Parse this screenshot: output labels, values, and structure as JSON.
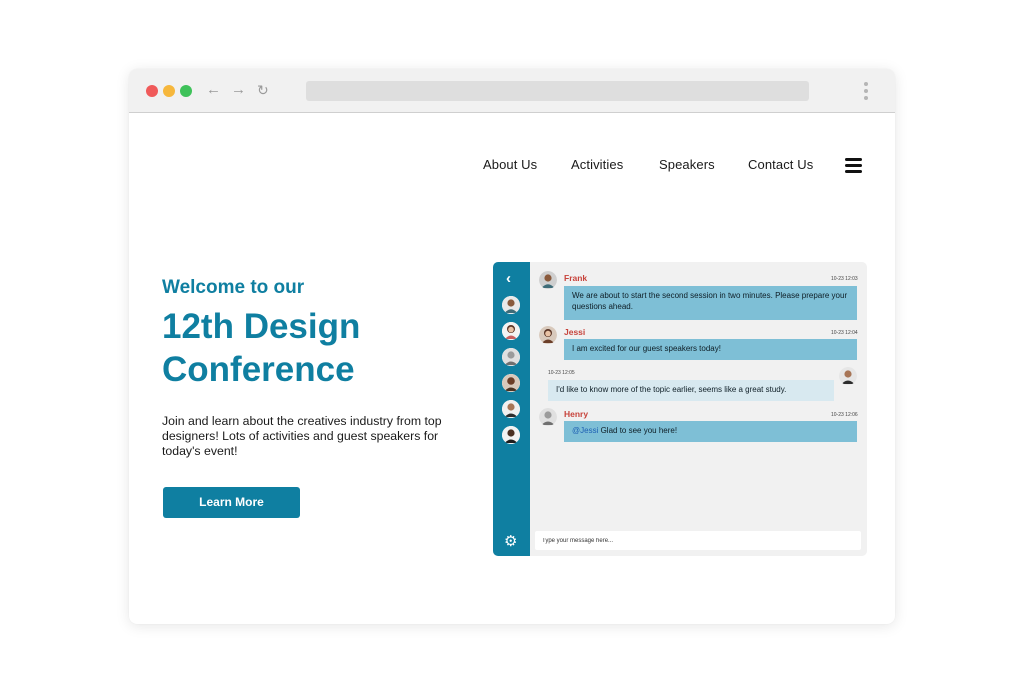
{
  "browser": {
    "back_icon": "←",
    "forward_icon": "→",
    "reload_icon": "↻"
  },
  "nav": {
    "about": "About Us",
    "activities": "Activities",
    "speakers": "Speakers",
    "contact": "Contact Us"
  },
  "hero": {
    "welcome": "Welcome to our",
    "title": "12th Design Conference",
    "description": "Join and learn about the creatives industry from top designers! Lots of activities and guest speakers for today's event!",
    "cta": "Learn More"
  },
  "chat": {
    "back_icon": "‹",
    "gear_icon": "⚙",
    "input_placeholder": "Type your message here...",
    "messages": [
      {
        "name": "Frank",
        "time": "10-23 12:03",
        "text": "We are about to start the second session in two minutes. Please prepare your questions ahead."
      },
      {
        "name": "Jessi",
        "time": "10-23 12:04",
        "text": "I am excited for our guest speakers today!"
      },
      {
        "name": "",
        "time": "10-23 12:05",
        "text": "I'd like to know more of the topic earlier, seems like a great study."
      },
      {
        "name": "Henry",
        "time": "10-23 12:06",
        "mention": "@Jessi",
        "text": " Glad to see you here!"
      }
    ]
  },
  "colors": {
    "accent": "#0f7fa1",
    "bubble": "#7ebfd6",
    "bubble_light": "#d8e9f0",
    "name": "#c7433b"
  }
}
